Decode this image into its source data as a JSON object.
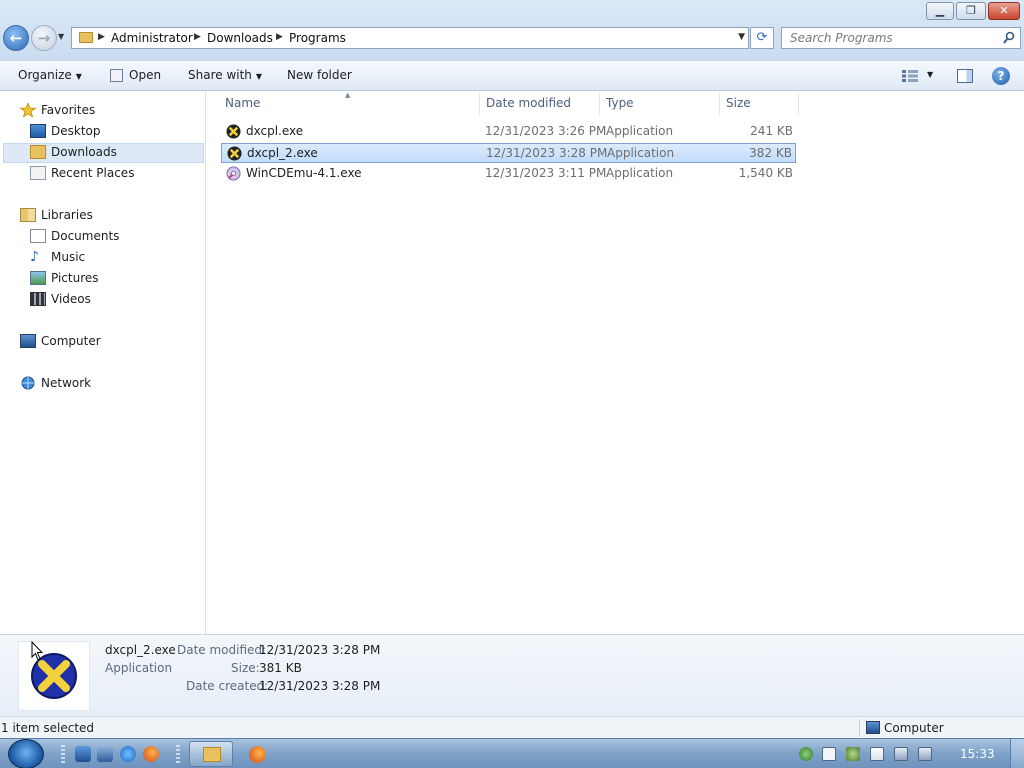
{
  "window": {
    "minimize_glyph": "▁",
    "maximize_glyph": "❐",
    "close_glyph": "✕"
  },
  "address": {
    "crumbs": [
      "Administrator",
      "Downloads",
      "Programs"
    ],
    "separator": "▶",
    "dropdown": "▼",
    "refresh": "⟳"
  },
  "search": {
    "placeholder": "Search Programs"
  },
  "commandbar": {
    "organize": "Organize",
    "open": "Open",
    "share_with": "Share with",
    "new_folder": "New folder",
    "dropdown": "▼",
    "help": "?"
  },
  "navpane": {
    "favorites": "Favorites",
    "desktop": "Desktop",
    "downloads": "Downloads",
    "recent_places": "Recent Places",
    "libraries": "Libraries",
    "documents": "Documents",
    "music": "Music",
    "pictures": "Pictures",
    "videos": "Videos",
    "computer": "Computer",
    "network": "Network"
  },
  "filelist": {
    "columns": {
      "name": "Name",
      "date": "Date modified",
      "type": "Type",
      "size": "Size"
    },
    "sort_indicator": "▲",
    "rows": [
      {
        "name": "dxcpl.exe",
        "date": "12/31/2023 3:26 PM",
        "type": "Application",
        "size": "241 KB",
        "icon": "directx-icon",
        "selected": false
      },
      {
        "name": "dxcpl_2.exe",
        "date": "12/31/2023 3:28 PM",
        "type": "Application",
        "size": "382 KB",
        "icon": "directx-icon",
        "selected": true
      },
      {
        "name": "WinCDEmu-4.1.exe",
        "date": "12/31/2023 3:11 PM",
        "type": "Application",
        "size": "1,540 KB",
        "icon": "wincdemu-icon",
        "selected": false
      }
    ]
  },
  "details": {
    "name": "dxcpl_2.exe",
    "kind": "Application",
    "date_modified_label": "Date modified:",
    "date_modified": "12/31/2023 3:28 PM",
    "size_label": "Size:",
    "size": "381 KB",
    "date_created_label": "Date created:",
    "date_created": "12/31/2023 3:28 PM"
  },
  "statusbar": {
    "selection": "1 item selected",
    "location": "Computer"
  },
  "taskbar": {
    "clock": "15:33"
  },
  "colors": {
    "selection_bg": "#c1dcfc",
    "accent": "#2a69b5"
  }
}
